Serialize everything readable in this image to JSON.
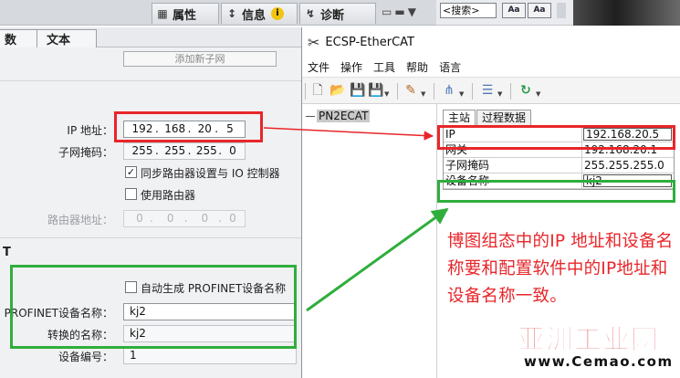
{
  "tia": {
    "tabs": [
      {
        "label": "属性"
      },
      {
        "label": "信息"
      },
      {
        "label": "诊断"
      }
    ],
    "search_placeholder": "<搜索>",
    "search_btn1": "Aa",
    "search_btn2": "Aa",
    "subtabs": [
      {
        "label": "数"
      },
      {
        "label": "文本"
      }
    ],
    "add_submodule_label": "添加新子网",
    "ip_label": "IP 地址：",
    "ip": [
      "192",
      "168",
      "20",
      "5"
    ],
    "subnet_label": "子网掩码：",
    "subnet": [
      "255",
      "255",
      "255",
      "0"
    ],
    "sync_router_label": "同步路由器设置与 IO 控制器",
    "sync_router_checked": true,
    "use_router_label": "使用路由器",
    "use_router_checked": false,
    "router_addr_label": "路由器地址：",
    "router_addr": [
      "0",
      "0",
      "0",
      "0"
    ],
    "section_t": "T",
    "auto_name_label": "自动生成 PROFINET设备名称",
    "auto_name_checked": false,
    "profinet_name_label": "PROFINET设备名称：",
    "profinet_name": "kj2",
    "converted_name_label": "转换的名称：",
    "converted_name": "kj2",
    "device_number_label": "设备编号：",
    "device_number": "1"
  },
  "ecsp": {
    "title": "ECSP-EtherCAT",
    "menu": [
      {
        "label": "文件"
      },
      {
        "label": "操作"
      },
      {
        "label": "工具"
      },
      {
        "label": "帮助"
      },
      {
        "label": "语言"
      }
    ],
    "tree_item": "PN2ECAT",
    "tabs": [
      {
        "label": "主站"
      },
      {
        "label": "过程数据"
      }
    ],
    "rows": [
      {
        "key": "IP",
        "value": "192.168.20.5"
      },
      {
        "key": "网关",
        "value": "192.168.20.1"
      },
      {
        "key": "子网掩码",
        "value": "255.255.255.0"
      },
      {
        "key": "设备名称",
        "value": "kj2"
      }
    ]
  },
  "annotation": {
    "note": "博图组态中的IP 地址和设备名称要和配置软件中的IP地址和设备名称一致。"
  },
  "watermark": {
    "cn": "亚洲工业网",
    "en": "www.Cemao.com"
  },
  "colors": {
    "highlight_red": "#e8262a",
    "highlight_green": "#2fae3c",
    "watermark_red": "#d8141b"
  },
  "icons": {
    "properties": "properties-icon",
    "info": "info-icon",
    "diagnostics": "diagnostics-icon",
    "tool": "tool-icon"
  }
}
